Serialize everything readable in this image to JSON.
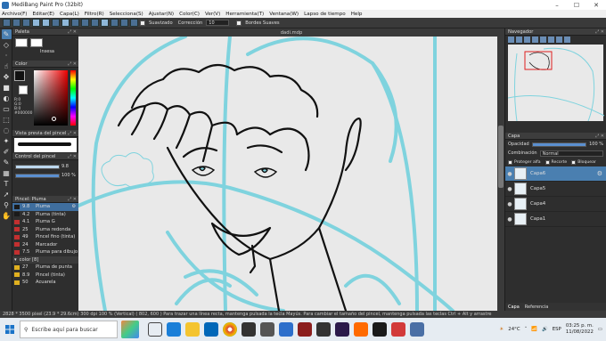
{
  "window": {
    "title": "MediBang Paint Pro (32bit)",
    "controls": [
      "–",
      "☐",
      "✕"
    ]
  },
  "menu": [
    "Archivo(F)",
    "Editar(E)",
    "Capa(L)",
    "Filtro(R)",
    "Selecciona(S)",
    "Ajustar(N)",
    "Color(C)",
    "Ver(V)",
    "Herramienta(T)",
    "Ventana(W)",
    "Lapso de tiempo",
    "Help"
  ],
  "toolbar": {
    "suavizado_label": "Suavizado",
    "correccion_label": "Corrección",
    "correccion_value": "10",
    "bordes_label": "Bordes Suaves"
  },
  "canvas": {
    "tab_title": "dadi.mdp"
  },
  "panels": {
    "paleta": {
      "title": "Paleta",
      "item": "Insesa"
    },
    "color": {
      "title": "Color",
      "values": [
        "R:0",
        "G:0",
        "B:0",
        "#000000"
      ]
    },
    "vista_previa": {
      "title": "Vista previa del pincel"
    },
    "control_pincel": {
      "title": "Control del pincel",
      "size": "9.8",
      "opacity": "100 %"
    },
    "pincel": {
      "title": "Pincel: Pluma",
      "brushes": [
        {
          "size": "9.8",
          "name": "Pluma",
          "color": "#1a1a1a",
          "selected": true
        },
        {
          "size": "4.2",
          "name": "Pluma (tinta)",
          "color": "#1a1a1a"
        },
        {
          "size": "4.1",
          "name": "Pluma G",
          "color": "#c23030"
        },
        {
          "size": "25",
          "name": "Pluma redonda",
          "color": "#c23030"
        },
        {
          "size": "49",
          "name": "Pincel fino (tinta)",
          "color": "#c23030"
        },
        {
          "size": "24",
          "name": "Marcador",
          "color": "#c23030"
        },
        {
          "size": "7.5",
          "name": "Pluma para dibujo",
          "color": "#c23030"
        }
      ],
      "group": "color [8]",
      "group_brushes": [
        {
          "size": "27",
          "name": "Pluma de punta",
          "color": "#e0b020"
        },
        {
          "size": "8.9",
          "name": "Pincel (tinta)",
          "color": "#e0b020"
        },
        {
          "size": "50",
          "name": "Acuarela",
          "color": "#e0b020"
        }
      ]
    },
    "navegador": {
      "title": "Navegador"
    },
    "capa": {
      "title": "Capa",
      "opacity_label": "Opacidad",
      "opacity_value": "100 %",
      "blend_label": "Combinación",
      "blend_value": "Normal",
      "checks": [
        "Proteger alfa",
        "Recorte",
        "Bloquear"
      ],
      "layers": [
        {
          "name": "Capa6",
          "selected": true
        },
        {
          "name": "Capa5"
        },
        {
          "name": "Capa4"
        },
        {
          "name": "Capa1"
        }
      ],
      "tabs": [
        "Capa",
        "Referencia"
      ]
    }
  },
  "status": {
    "text": "2828 * 3500 pixel   (23.9 * 29.6cm)   300 dpi   100 %   (Vertical) ( 802, 600 )   Para trazar una línea recta, mantenga pulsada la tecla Mayús. Para cambiar el tamaño del pincel, mantenga pulsada las teclas Ctrl + Alt y arrastre"
  },
  "taskbar": {
    "search_placeholder": "Escribe aquí para buscar",
    "weather": "24°C",
    "language": "ESP",
    "time": "03:25 p. m.",
    "date": "11/08/2022"
  },
  "colors": {
    "accent": "#4a7fb0",
    "sketch_cyan": "#7fd3de",
    "ink": "#111111"
  }
}
